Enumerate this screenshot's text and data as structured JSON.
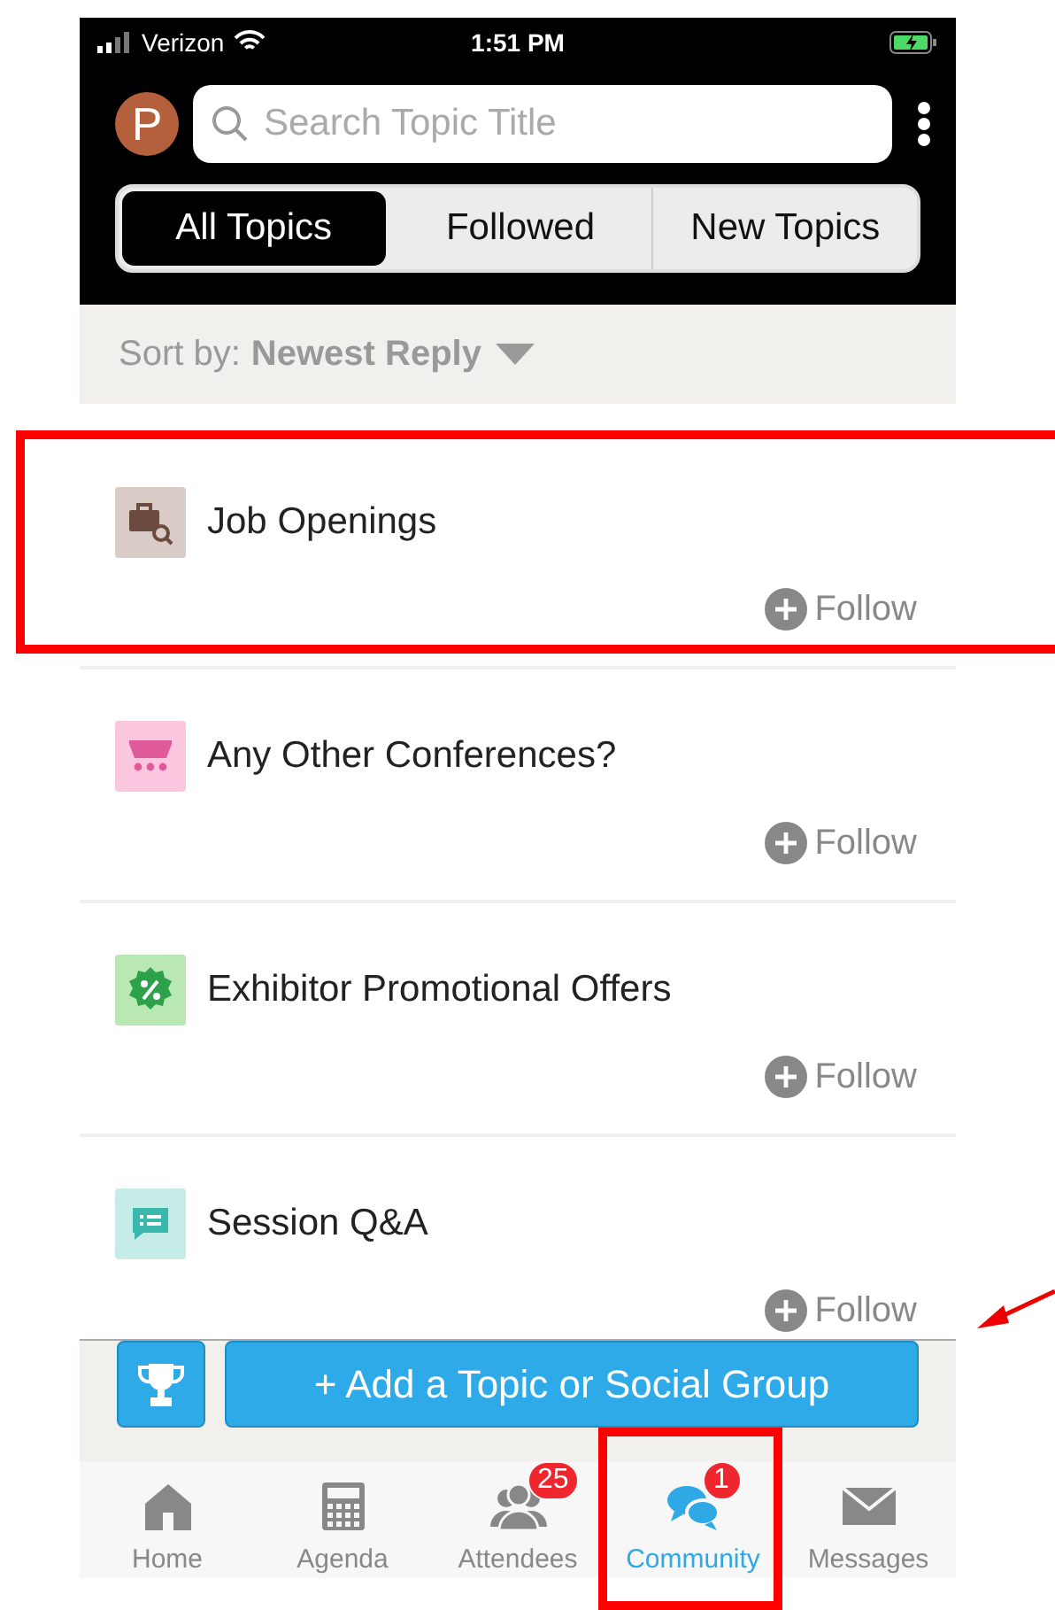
{
  "status_bar": {
    "carrier": "Verizon",
    "time": "1:51 PM"
  },
  "header": {
    "avatar_letter": "P",
    "search": {
      "placeholder": "Search Topic Title"
    },
    "segments": [
      {
        "label": "All Topics",
        "selected": true
      },
      {
        "label": "Followed",
        "selected": false
      },
      {
        "label": "New Topics",
        "selected": false
      }
    ]
  },
  "sort": {
    "label": "Sort by:",
    "value": "Newest Reply"
  },
  "topics": [
    {
      "title": "Job Openings",
      "kind": "jobs",
      "color": "#d9cbc6",
      "follow": "Follow"
    },
    {
      "title": "Any Other Conferences?",
      "kind": "cart",
      "color": "#fcc6df",
      "follow": "Follow"
    },
    {
      "title": "Exhibitor Promotional Offers",
      "kind": "offer",
      "color": "#b9e8b4",
      "follow": "Follow"
    },
    {
      "title": "Session Q&A",
      "kind": "qa",
      "color": "#c6ece8",
      "follow": "Follow"
    }
  ],
  "action_bar": {
    "add_button": "+ Add a Topic or Social Group"
  },
  "tab_bar": [
    {
      "label": "Home",
      "kind": "home",
      "selected": false
    },
    {
      "label": "Agenda",
      "kind": "agenda",
      "selected": false
    },
    {
      "label": "Attendees",
      "kind": "attendees",
      "selected": false,
      "badge": "25"
    },
    {
      "label": "Community",
      "kind": "community",
      "selected": true,
      "badge": "1"
    },
    {
      "label": "Messages",
      "kind": "messages",
      "selected": false
    }
  ]
}
